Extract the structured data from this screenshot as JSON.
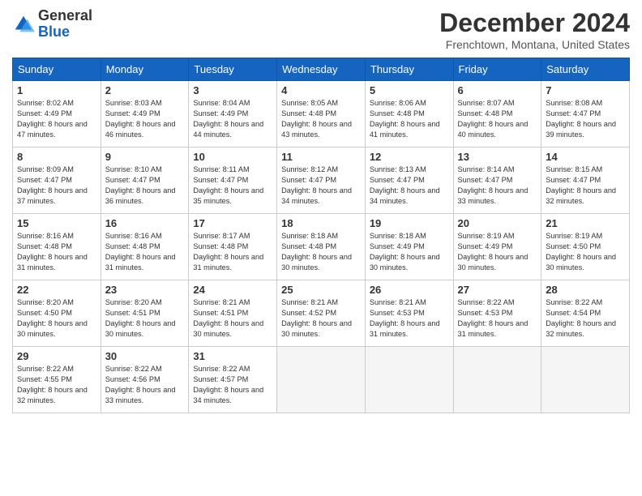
{
  "logo": {
    "text_general": "General",
    "text_blue": "Blue"
  },
  "header": {
    "month": "December 2024",
    "location": "Frenchtown, Montana, United States"
  },
  "days_of_week": [
    "Sunday",
    "Monday",
    "Tuesday",
    "Wednesday",
    "Thursday",
    "Friday",
    "Saturday"
  ],
  "weeks": [
    [
      {
        "day": "1",
        "sunrise": "8:02 AM",
        "sunset": "4:49 PM",
        "daylight": "8 hours and 47 minutes."
      },
      {
        "day": "2",
        "sunrise": "8:03 AM",
        "sunset": "4:49 PM",
        "daylight": "8 hours and 46 minutes."
      },
      {
        "day": "3",
        "sunrise": "8:04 AM",
        "sunset": "4:49 PM",
        "daylight": "8 hours and 44 minutes."
      },
      {
        "day": "4",
        "sunrise": "8:05 AM",
        "sunset": "4:48 PM",
        "daylight": "8 hours and 43 minutes."
      },
      {
        "day": "5",
        "sunrise": "8:06 AM",
        "sunset": "4:48 PM",
        "daylight": "8 hours and 41 minutes."
      },
      {
        "day": "6",
        "sunrise": "8:07 AM",
        "sunset": "4:48 PM",
        "daylight": "8 hours and 40 minutes."
      },
      {
        "day": "7",
        "sunrise": "8:08 AM",
        "sunset": "4:47 PM",
        "daylight": "8 hours and 39 minutes."
      }
    ],
    [
      {
        "day": "8",
        "sunrise": "8:09 AM",
        "sunset": "4:47 PM",
        "daylight": "8 hours and 37 minutes."
      },
      {
        "day": "9",
        "sunrise": "8:10 AM",
        "sunset": "4:47 PM",
        "daylight": "8 hours and 36 minutes."
      },
      {
        "day": "10",
        "sunrise": "8:11 AM",
        "sunset": "4:47 PM",
        "daylight": "8 hours and 35 minutes."
      },
      {
        "day": "11",
        "sunrise": "8:12 AM",
        "sunset": "4:47 PM",
        "daylight": "8 hours and 34 minutes."
      },
      {
        "day": "12",
        "sunrise": "8:13 AM",
        "sunset": "4:47 PM",
        "daylight": "8 hours and 34 minutes."
      },
      {
        "day": "13",
        "sunrise": "8:14 AM",
        "sunset": "4:47 PM",
        "daylight": "8 hours and 33 minutes."
      },
      {
        "day": "14",
        "sunrise": "8:15 AM",
        "sunset": "4:47 PM",
        "daylight": "8 hours and 32 minutes."
      }
    ],
    [
      {
        "day": "15",
        "sunrise": "8:16 AM",
        "sunset": "4:48 PM",
        "daylight": "8 hours and 31 minutes."
      },
      {
        "day": "16",
        "sunrise": "8:16 AM",
        "sunset": "4:48 PM",
        "daylight": "8 hours and 31 minutes."
      },
      {
        "day": "17",
        "sunrise": "8:17 AM",
        "sunset": "4:48 PM",
        "daylight": "8 hours and 31 minutes."
      },
      {
        "day": "18",
        "sunrise": "8:18 AM",
        "sunset": "4:48 PM",
        "daylight": "8 hours and 30 minutes."
      },
      {
        "day": "19",
        "sunrise": "8:18 AM",
        "sunset": "4:49 PM",
        "daylight": "8 hours and 30 minutes."
      },
      {
        "day": "20",
        "sunrise": "8:19 AM",
        "sunset": "4:49 PM",
        "daylight": "8 hours and 30 minutes."
      },
      {
        "day": "21",
        "sunrise": "8:19 AM",
        "sunset": "4:50 PM",
        "daylight": "8 hours and 30 minutes."
      }
    ],
    [
      {
        "day": "22",
        "sunrise": "8:20 AM",
        "sunset": "4:50 PM",
        "daylight": "8 hours and 30 minutes."
      },
      {
        "day": "23",
        "sunrise": "8:20 AM",
        "sunset": "4:51 PM",
        "daylight": "8 hours and 30 minutes."
      },
      {
        "day": "24",
        "sunrise": "8:21 AM",
        "sunset": "4:51 PM",
        "daylight": "8 hours and 30 minutes."
      },
      {
        "day": "25",
        "sunrise": "8:21 AM",
        "sunset": "4:52 PM",
        "daylight": "8 hours and 30 minutes."
      },
      {
        "day": "26",
        "sunrise": "8:21 AM",
        "sunset": "4:53 PM",
        "daylight": "8 hours and 31 minutes."
      },
      {
        "day": "27",
        "sunrise": "8:22 AM",
        "sunset": "4:53 PM",
        "daylight": "8 hours and 31 minutes."
      },
      {
        "day": "28",
        "sunrise": "8:22 AM",
        "sunset": "4:54 PM",
        "daylight": "8 hours and 32 minutes."
      }
    ],
    [
      {
        "day": "29",
        "sunrise": "8:22 AM",
        "sunset": "4:55 PM",
        "daylight": "8 hours and 32 minutes."
      },
      {
        "day": "30",
        "sunrise": "8:22 AM",
        "sunset": "4:56 PM",
        "daylight": "8 hours and 33 minutes."
      },
      {
        "day": "31",
        "sunrise": "8:22 AM",
        "sunset": "4:57 PM",
        "daylight": "8 hours and 34 minutes."
      },
      null,
      null,
      null,
      null
    ]
  ],
  "labels": {
    "sunrise": "Sunrise:",
    "sunset": "Sunset:",
    "daylight": "Daylight:"
  }
}
